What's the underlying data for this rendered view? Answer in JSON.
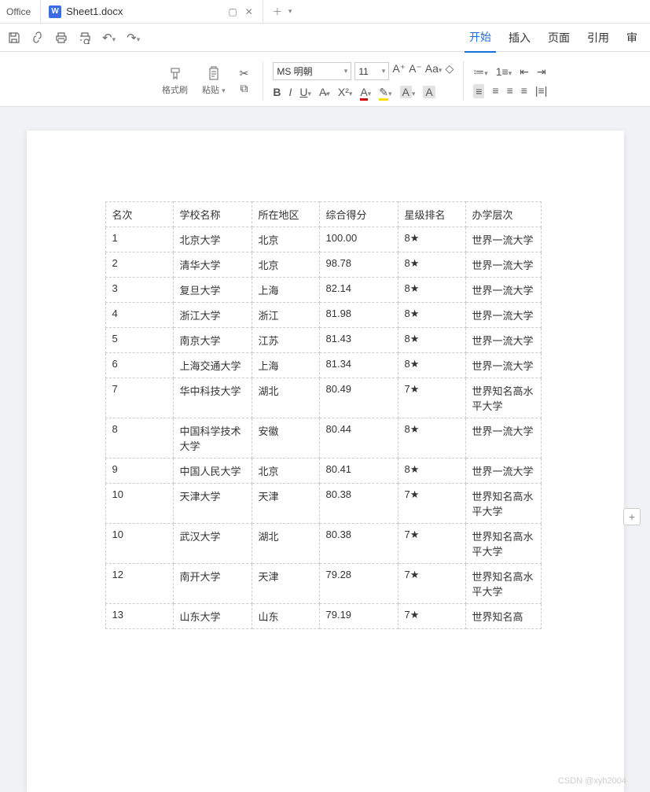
{
  "app": {
    "badge": "Office"
  },
  "tab": {
    "icon_letter": "W",
    "title": "Sheet1.docx"
  },
  "menu": {
    "start": "开始",
    "insert": "插入",
    "page": "页面",
    "reference": "引用",
    "review": "审"
  },
  "ribbon": {
    "format_brush": "格式刷",
    "paste": "粘贴",
    "font_name": "MS 明朝",
    "font_size": "11"
  },
  "table": {
    "headers": [
      "名次",
      "学校名称",
      "所在地区",
      "综合得分",
      "星级排名",
      "办学层次"
    ],
    "rows": [
      [
        "1",
        "北京大学",
        "北京",
        "100.00",
        "8★",
        "世界一流大学"
      ],
      [
        "2",
        "清华大学",
        "北京",
        "98.78",
        "8★",
        "世界一流大学"
      ],
      [
        "3",
        "复旦大学",
        "上海",
        "82.14",
        "8★",
        "世界一流大学"
      ],
      [
        "4",
        "浙江大学",
        "浙江",
        "81.98",
        "8★",
        "世界一流大学"
      ],
      [
        "5",
        "南京大学",
        "江苏",
        "81.43",
        "8★",
        "世界一流大学"
      ],
      [
        "6",
        "上海交通大学",
        "上海",
        "81.34",
        "8★",
        "世界一流大学"
      ],
      [
        "7",
        "华中科技大学",
        "湖北",
        "80.49",
        "7★",
        "世界知名高水平大学"
      ],
      [
        "8",
        "中国科学技术大学",
        "安徽",
        "80.44",
        "8★",
        "世界一流大学"
      ],
      [
        "9",
        "中国人民大学",
        "北京",
        "80.41",
        "8★",
        "世界一流大学"
      ],
      [
        "10",
        "天津大学",
        "天津",
        "80.38",
        "7★",
        "世界知名高水平大学"
      ],
      [
        "10",
        "武汉大学",
        "湖北",
        "80.38",
        "7★",
        "世界知名高水平大学"
      ],
      [
        "12",
        "南开大学",
        "天津",
        "79.28",
        "7★",
        "世界知名高水平大学"
      ],
      [
        "13",
        "山东大学",
        "山东",
        "79.19",
        "7★",
        "世界知名高"
      ]
    ]
  },
  "watermark": "CSDN @xyh2004"
}
